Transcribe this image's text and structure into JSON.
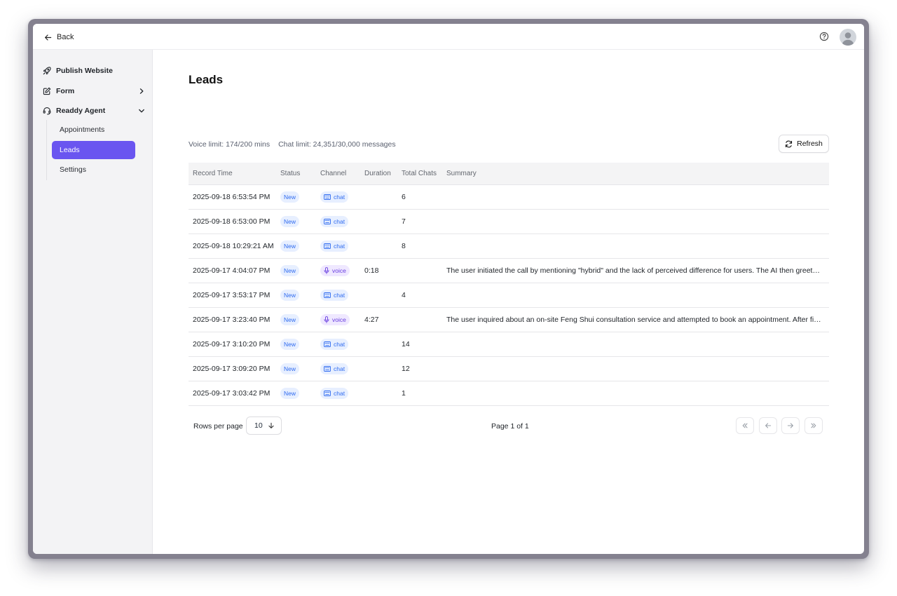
{
  "topbar": {
    "back_label": "Back"
  },
  "sidebar": {
    "publish_label": "Publish Website",
    "form_label": "Form",
    "agent_label": "Readdy Agent",
    "sub_items": [
      "Appointments",
      "Leads",
      "Settings"
    ],
    "active_sub": "Leads"
  },
  "main": {
    "title": "Leads",
    "voice_limit": "Voice limit: 174/200 mins",
    "chat_limit": "Chat limit: 24,351/30,000 messages",
    "refresh_label": "Refresh"
  },
  "table": {
    "columns": [
      "Record Time",
      "Status",
      "Channel",
      "Duration",
      "Total Chats",
      "Summary"
    ],
    "rows": [
      {
        "time": "2025-09-18 6:53:54 PM",
        "status": "New",
        "channel": "chat",
        "duration": "",
        "total_chats": "6",
        "summary": ""
      },
      {
        "time": "2025-09-18 6:53:00 PM",
        "status": "New",
        "channel": "chat",
        "duration": "",
        "total_chats": "7",
        "summary": ""
      },
      {
        "time": "2025-09-18 10:29:21 AM",
        "status": "New",
        "channel": "chat",
        "duration": "",
        "total_chats": "8",
        "summary": ""
      },
      {
        "time": "2025-09-17 4:04:07 PM",
        "status": "New",
        "channel": "voice",
        "duration": "0:18",
        "total_chats": "",
        "summary": "The user initiated the call by mentioning \"hybrid\" and the lack of perceived difference for users. The AI then greet…"
      },
      {
        "time": "2025-09-17 3:53:17 PM",
        "status": "New",
        "channel": "chat",
        "duration": "",
        "total_chats": "4",
        "summary": ""
      },
      {
        "time": "2025-09-17 3:23:40 PM",
        "status": "New",
        "channel": "voice",
        "duration": "4:27",
        "total_chats": "",
        "summary": "The user inquired about an on-site Feng Shui consultation service and attempted to book an appointment. After fi…"
      },
      {
        "time": "2025-09-17 3:10:20 PM",
        "status": "New",
        "channel": "chat",
        "duration": "",
        "total_chats": "14",
        "summary": ""
      },
      {
        "time": "2025-09-17 3:09:20 PM",
        "status": "New",
        "channel": "chat",
        "duration": "",
        "total_chats": "12",
        "summary": ""
      },
      {
        "time": "2025-09-17 3:03:42 PM",
        "status": "New",
        "channel": "chat",
        "duration": "",
        "total_chats": "1",
        "summary": ""
      }
    ]
  },
  "pagination": {
    "rows_label": "Rows per page",
    "rows_value": "10",
    "page_info": "Page 1 of 1"
  },
  "colors": {
    "accent": "#6a55f0",
    "badge_blue_bg": "#e7efff",
    "badge_blue_text": "#2f6bf0",
    "badge_voice_bg": "#efe8ff",
    "badge_voice_text": "#6a3fe0"
  },
  "icons": {
    "back": "arrow-left-icon",
    "help": "help-circle-icon",
    "avatar": "user-avatar-icon",
    "publish": "rocket-icon",
    "form": "edit-square-icon",
    "agent": "headset-icon",
    "refresh": "refresh-icon",
    "chat": "keyboard-icon",
    "voice": "microphone-icon"
  }
}
